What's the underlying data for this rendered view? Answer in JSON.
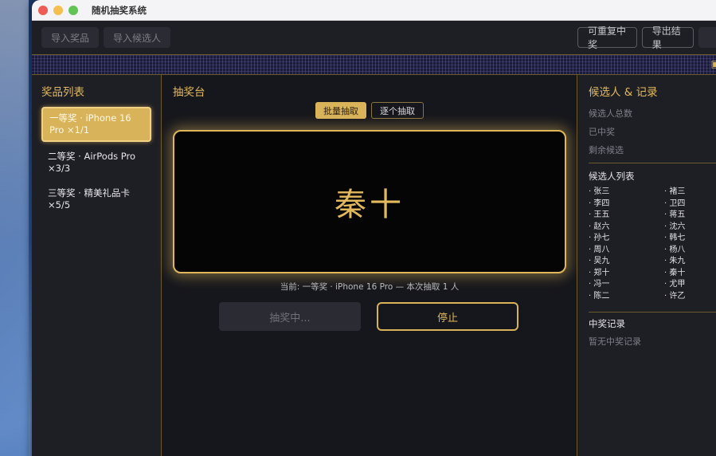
{
  "window": {
    "title": "随机抽奖系统"
  },
  "toolbar": {
    "import_prizes": "导入奖品",
    "import_candidates": "导入候选人",
    "allow_repeat": "可重复中奖",
    "export_results": "导出结果"
  },
  "prizes": {
    "title": "奖品列表",
    "items": [
      {
        "label": "一等奖 · iPhone 16 Pro ×1/1"
      },
      {
        "label": "二等奖 · AirPods Pro ×3/3"
      },
      {
        "label": "三等奖 · 精美礼品卡 ×5/5"
      }
    ]
  },
  "stage": {
    "title": "抽奖台",
    "mode_batch": "批量抽取",
    "mode_single": "逐个抽取",
    "current_name": "秦十",
    "caption": "当前: 一等奖 · iPhone 16 Pro — 本次抽取 1 人",
    "drawing_label": "抽奖中...",
    "stop_label": "停止"
  },
  "candidates": {
    "title": "候选人 & 记录",
    "total_label": "候选人总数",
    "won_label": "已中奖",
    "remaining_label": "剩余候选",
    "list_title": "候选人列表",
    "names": [
      "· 张三",
      "· 褚三",
      "· 李四",
      "· 卫四",
      "· 王五",
      "· 蒋五",
      "· 赵六",
      "· 沈六",
      "· 孙七",
      "· 韩七",
      "· 周八",
      "· 杨八",
      "· 吴九",
      "· 朱九",
      "· 郑十",
      "· 秦十",
      "· 冯一",
      "· 尤甲",
      "· 陈二",
      "· 许乙"
    ]
  },
  "records": {
    "title": "中奖记录",
    "empty": "暂无中奖记录"
  }
}
